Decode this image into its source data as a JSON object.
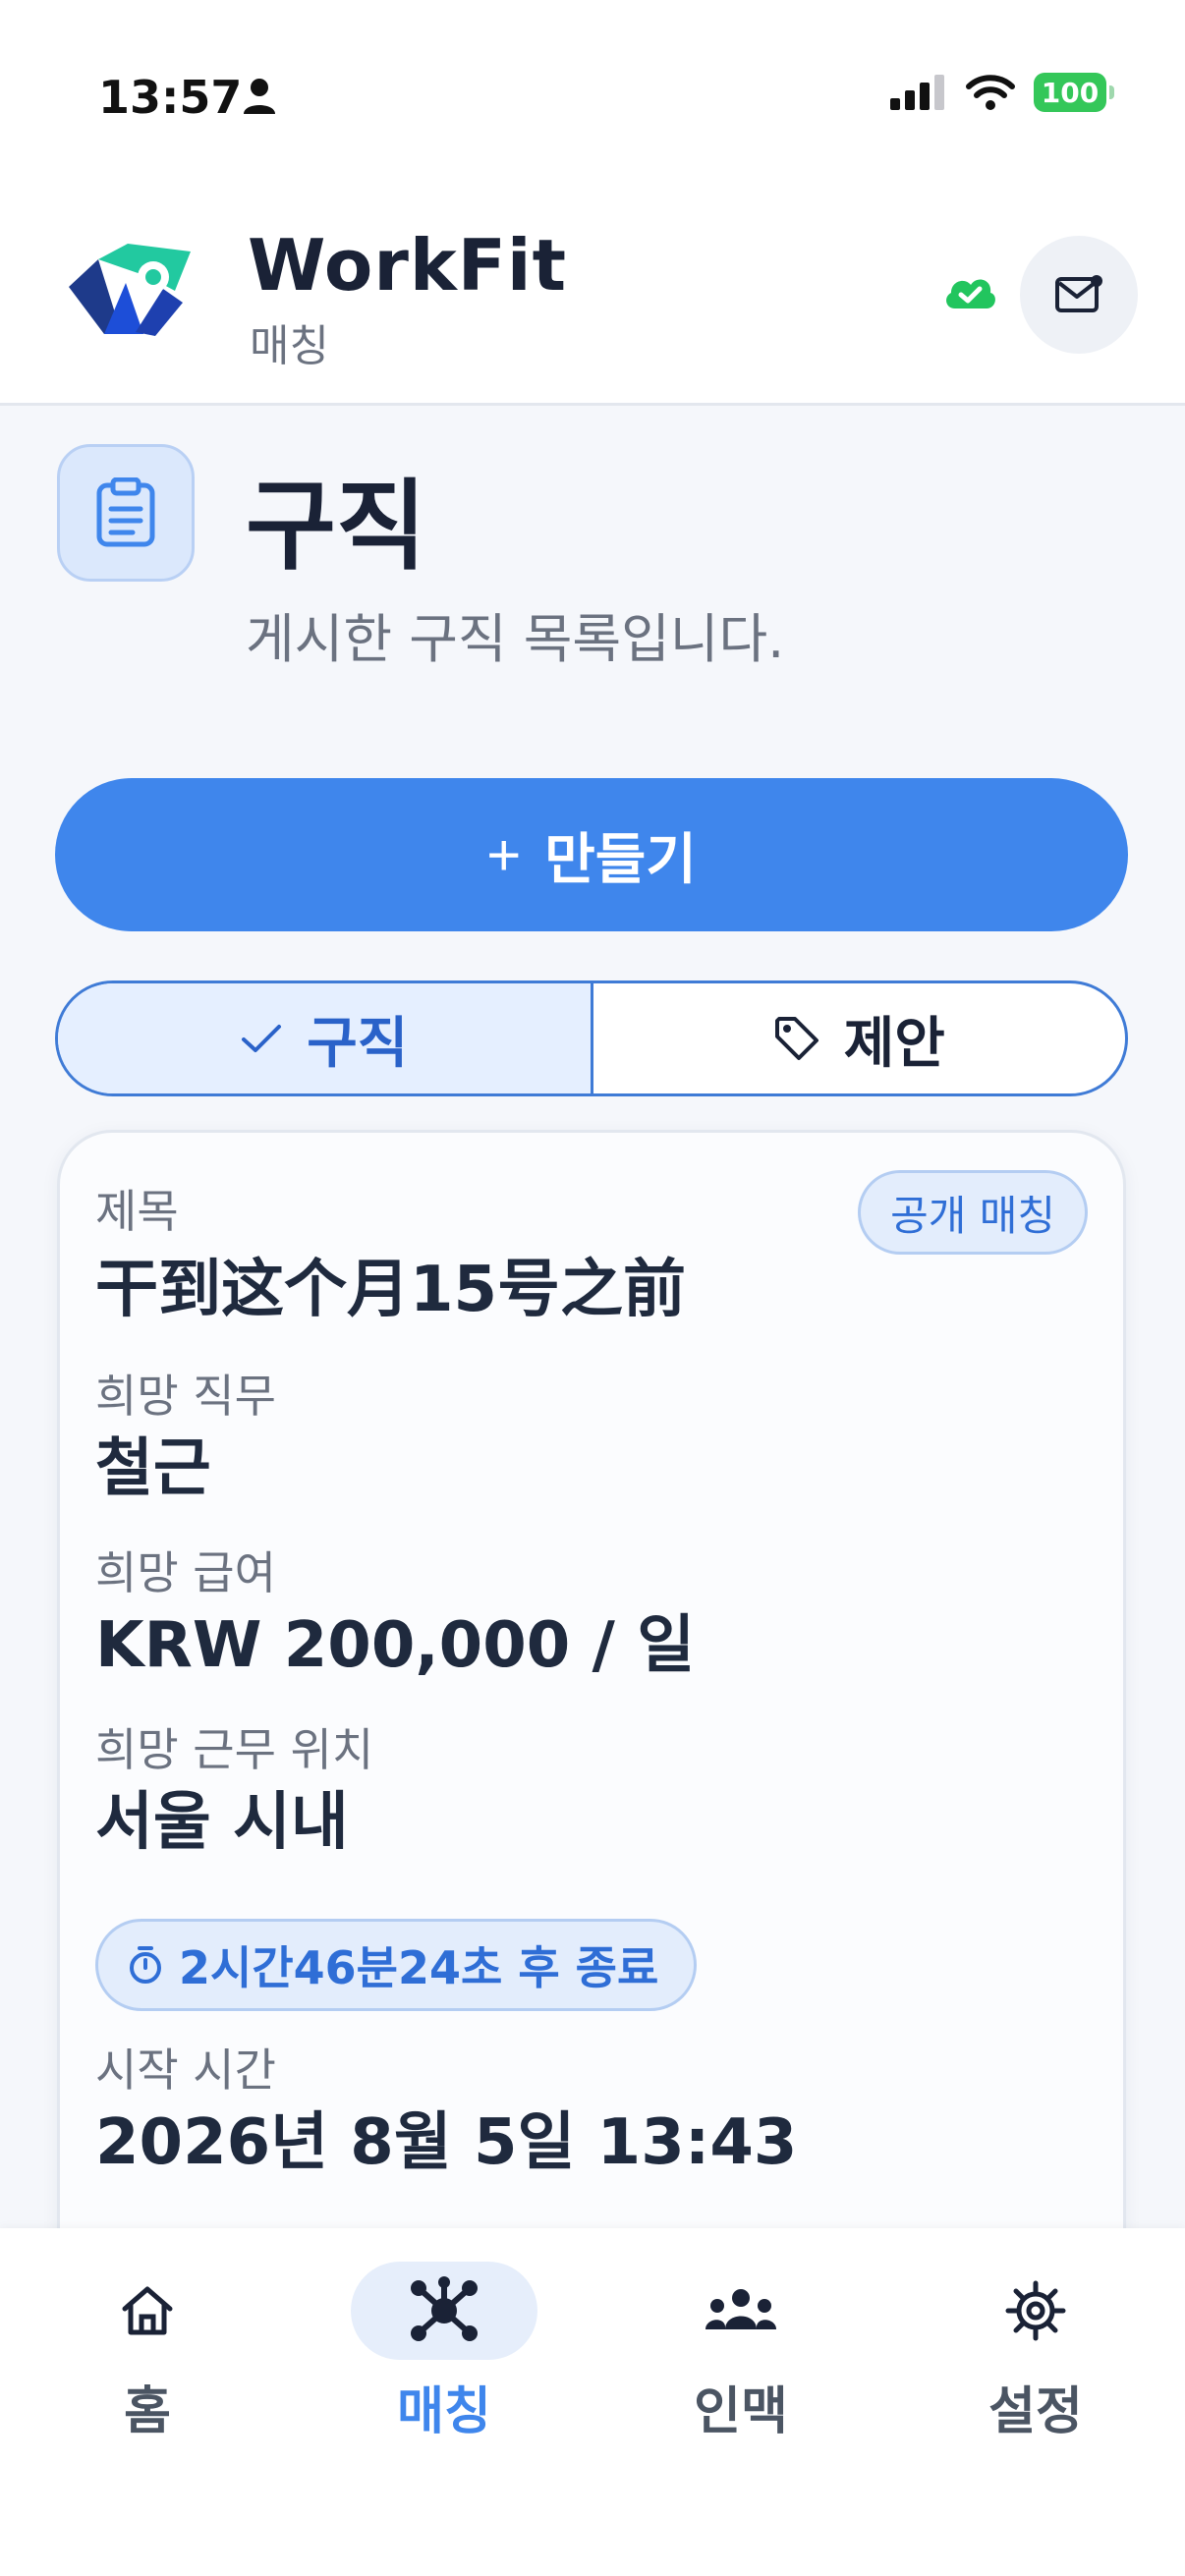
{
  "status_bar": {
    "time": "13:57",
    "battery": "100"
  },
  "header": {
    "app_name": "WorkFit",
    "subtitle": "매칭"
  },
  "page": {
    "title": "구직",
    "description": "게시한 구직 목록입니다."
  },
  "create_button": {
    "plus": "+",
    "label": "만들기"
  },
  "segments": [
    {
      "label": "구직",
      "active": true
    },
    {
      "label": "제안",
      "active": false
    }
  ],
  "card": {
    "badge": "공개 매칭",
    "title_label": "제목",
    "title_value": "干到这个月15号之前",
    "job_label": "희망 직무",
    "job_value": "철근",
    "salary_label": "희망 급여",
    "salary_value": "KRW 200,000 / 일",
    "location_label": "희망 근무 위치",
    "location_value": "서울 시내",
    "timer": "2시간46분24초 후 종료",
    "start_label": "시작 시간",
    "start_value": "2026년 8월 5일 13:43"
  },
  "bottom_nav": [
    {
      "label": "홈",
      "icon": "home-icon"
    },
    {
      "label": "매칭",
      "icon": "network-icon",
      "active": true
    },
    {
      "label": "인맥",
      "icon": "people-icon"
    },
    {
      "label": "설정",
      "icon": "gear-icon"
    }
  ],
  "colors": {
    "primary": "#3f86ec",
    "dark_text": "#1a2236",
    "muted": "#6b7280",
    "sync_green": "#22c55e"
  }
}
